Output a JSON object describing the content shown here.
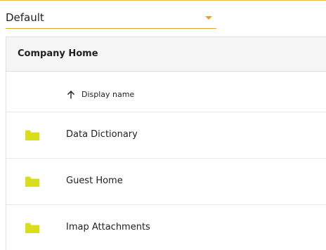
{
  "filter": {
    "selected": "Default"
  },
  "breadcrumb": {
    "title": "Company Home"
  },
  "table": {
    "sort_column": "Display name",
    "sort_direction_icon": "arrow-up-icon",
    "rows": [
      {
        "name": "Data Dictionary",
        "icon": "folder-icon"
      },
      {
        "name": "Guest Home",
        "icon": "folder-icon"
      },
      {
        "name": "Imap Attachments",
        "icon": "folder-icon"
      }
    ]
  },
  "colors": {
    "accent": "#e5a32d",
    "folder": "#d8df1a"
  }
}
